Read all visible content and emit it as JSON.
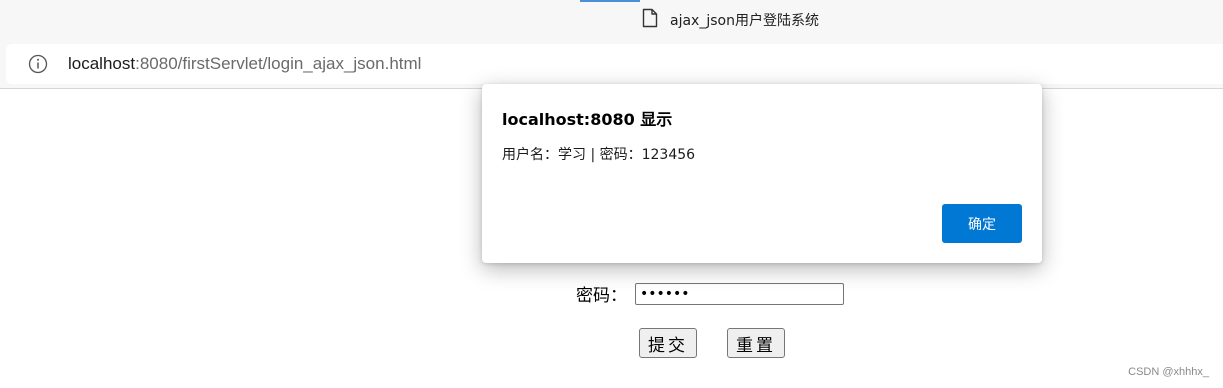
{
  "tab": {
    "title": "ajax_json用户登陆系统",
    "icon": "document-icon",
    "accent": "#4a90d9"
  },
  "address_bar": {
    "icon": "info-icon",
    "url_host": "localhost",
    "url_path": ":8080/firstServlet/login_ajax_json.html"
  },
  "form": {
    "password_label": "密码：",
    "password_value": "••••••",
    "submit_label": "提交",
    "reset_label": "重置"
  },
  "dialog": {
    "title": "localhost:8080 显示",
    "message": "用户名：学习 | 密码：123456",
    "ok_label": "确定",
    "ok_color": "#0078d4"
  },
  "watermark": "CSDN @xhhhx_"
}
